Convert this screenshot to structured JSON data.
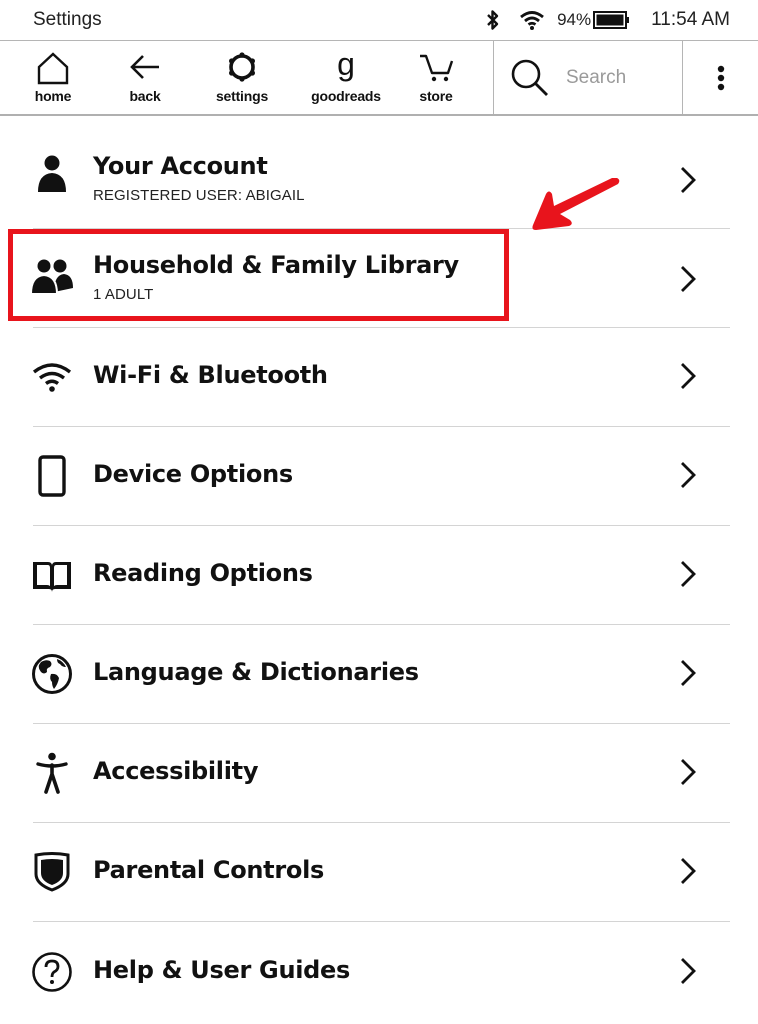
{
  "statusbar": {
    "title": "Settings",
    "battery_percent": "94%",
    "time": "11:54 AM",
    "icons": [
      "bluetooth-icon",
      "wifi-icon",
      "battery-icon"
    ]
  },
  "toolbar": {
    "buttons": [
      {
        "label": "home",
        "icon": "home-icon"
      },
      {
        "label": "back",
        "icon": "back-arrow-icon"
      },
      {
        "label": "settings",
        "icon": "settings-gear-icon"
      },
      {
        "label": "goodreads",
        "icon": "goodreads-icon"
      },
      {
        "label": "store",
        "icon": "cart-icon"
      }
    ],
    "search": {
      "placeholder": "Search",
      "icon": "search-icon"
    },
    "more_icon": "more-vertical-icon"
  },
  "settings": {
    "items": [
      {
        "title": "Your Account",
        "subtitle": "REGISTERED USER: ABIGAIL",
        "icon": "person-icon"
      },
      {
        "title": "Household & Family Library",
        "subtitle": "1 ADULT",
        "icon": "people-icon",
        "highlighted": true
      },
      {
        "title": "Wi-Fi & Bluetooth",
        "icon": "wifi-icon"
      },
      {
        "title": "Device Options",
        "icon": "device-icon"
      },
      {
        "title": "Reading Options",
        "icon": "book-icon"
      },
      {
        "title": "Language & Dictionaries",
        "icon": "globe-icon"
      },
      {
        "title": "Accessibility",
        "icon": "accessibility-icon"
      },
      {
        "title": "Parental Controls",
        "icon": "shield-icon"
      },
      {
        "title": "Help & User Guides",
        "icon": "help-icon"
      }
    ]
  },
  "annotation": {
    "color": "#e8141c",
    "target": "Household & Family Library"
  }
}
